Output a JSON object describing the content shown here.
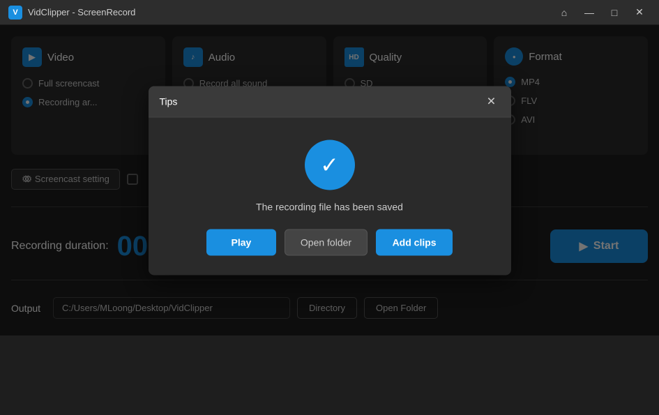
{
  "titleBar": {
    "appName": "VidClipper - ScreenRecord",
    "iconLabel": "V",
    "controls": {
      "home": "⌂",
      "minimize": "—",
      "maximize": "□",
      "close": "✕"
    }
  },
  "cards": [
    {
      "id": "video",
      "icon": "▶",
      "iconType": "video",
      "title": "Video",
      "options": [
        {
          "label": "Full screencast",
          "selected": false
        },
        {
          "label": "Recording ar...",
          "selected": true
        }
      ]
    },
    {
      "id": "audio",
      "icon": "🎵",
      "iconType": "audio",
      "title": "Audio",
      "options": [
        {
          "label": "Record all sound",
          "selected": false
        }
      ]
    },
    {
      "id": "quality",
      "icon": "HD",
      "iconType": "quality",
      "title": "Quality",
      "options": [
        {
          "label": "SD",
          "selected": false
        }
      ]
    },
    {
      "id": "format",
      "icon": "●",
      "iconType": "format",
      "title": "Format",
      "options": [
        {
          "label": "MP4",
          "selected": true
        },
        {
          "label": "FLV",
          "selected": false
        },
        {
          "label": "AVI",
          "selected": false
        }
      ]
    }
  ],
  "bottomControls": {
    "screenshotSettingLabel": "⚙ Screencast setting"
  },
  "duration": {
    "label": "Recording duration:",
    "timer": "00:00:00"
  },
  "startButton": {
    "icon": "▶",
    "label": "Start"
  },
  "output": {
    "label": "Output",
    "path": "C:/Users/MLoong/Desktop/VidClipper",
    "directoryLabel": "Directory",
    "openFolderLabel": "Open Folder"
  },
  "dialog": {
    "title": "Tips",
    "closeIcon": "✕",
    "message": "The recording file has been saved",
    "actions": {
      "play": "Play",
      "openFolder": "Open folder",
      "addClips": "Add clips"
    }
  }
}
